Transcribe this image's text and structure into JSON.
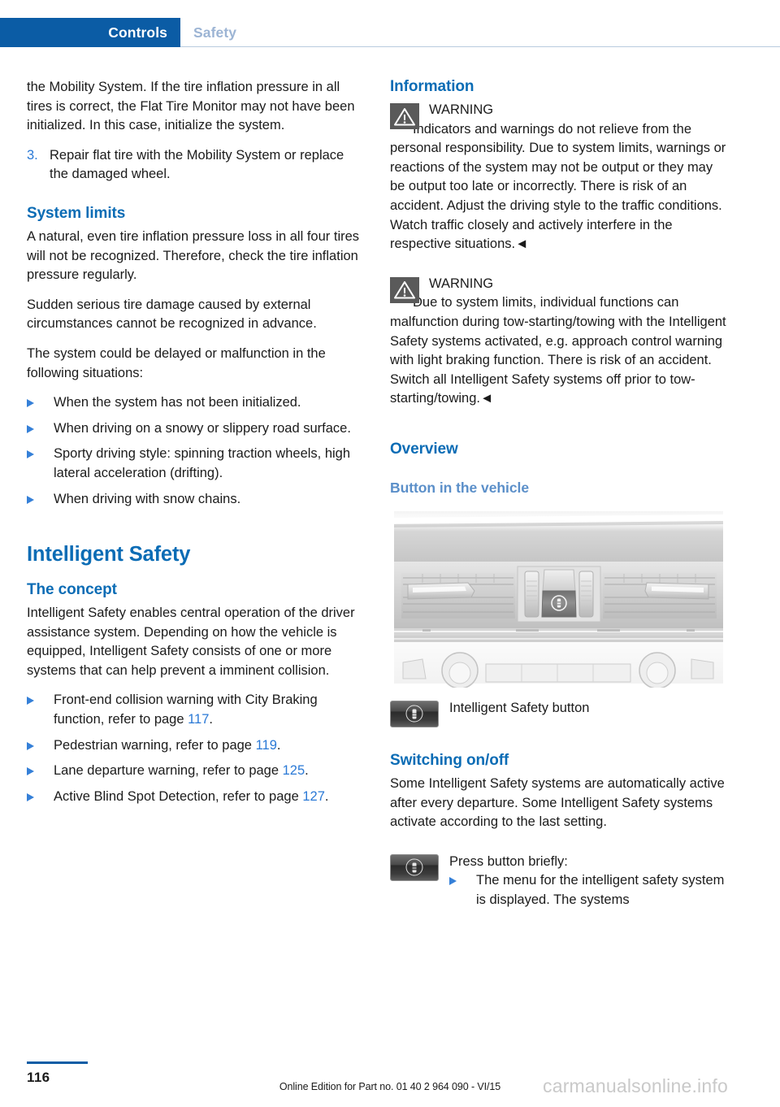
{
  "header": {
    "active_tab": "Controls",
    "inactive_tab": "Safety",
    "active_color": "#0b5ca5",
    "inactive_color": "#9cb4d4"
  },
  "left_column": {
    "continued_paragraph": "the Mobility System. If the tire inflation pressure in all tires is correct, the Flat Tire Monitor may not have been initialized. In this case, initialize the system.",
    "numbered_items": [
      {
        "number": "3.",
        "text": "Repair flat tire with the Mobility System or replace the damaged wheel."
      }
    ],
    "system_limits": {
      "heading": "System limits",
      "paragraphs": [
        "A natural, even tire inflation pressure loss in all four tires will not be recognized. Therefore, check the tire inflation pressure regularly.",
        "Sudden serious tire damage caused by external circumstances cannot be recognized in advance.",
        "The system could be delayed or malfunction in the following situations:"
      ],
      "bullets": [
        "When the system has not been initialized.",
        "When driving on a snowy or slippery road surface.",
        "Sporty driving style: spinning traction wheels, high lateral acceleration (drifting).",
        "When driving with snow chains."
      ]
    },
    "intelligent_safety": {
      "chapter_title": "Intelligent Safety",
      "concept_heading": "The concept",
      "concept_paragraph": "Intelligent Safety enables central operation of the driver assistance system. Depending on how the vehicle is equipped, Intelligent Safety consists of one or more systems that can help prevent a imminent collision.",
      "feature_bullets": [
        {
          "text_before": "Front-end collision warning with City Braking function, refer to page ",
          "page": "117",
          "text_after": "."
        },
        {
          "text_before": "Pedestrian warning, refer to page ",
          "page": "119",
          "text_after": "."
        },
        {
          "text_before": "Lane departure warning, refer to page ",
          "page": "125",
          "text_after": "."
        },
        {
          "text_before": "Active Blind Spot Detection, refer to page ",
          "page": "127",
          "text_after": "."
        }
      ]
    }
  },
  "right_column": {
    "information": {
      "heading": "Information",
      "warnings": [
        {
          "icon": "warning-triangle-icon",
          "title": "WARNING",
          "text": "Indicators and warnings do not relieve from the personal responsibility. Due to system limits, warnings or reactions of the system may not be output or they may be output too late or incorrectly. There is risk of an accident. Adjust the driving style to the traffic conditions. Watch traffic closely and actively interfere in the respective situations.◄"
        },
        {
          "icon": "warning-triangle-icon",
          "title": "WARNING",
          "text": "Due to system limits, individual functions can malfunction during tow-starting/towing with the Intelligent Safety systems activated, e.g. approach control warning with light braking function. There is risk of an accident. Switch all Intelligent Safety systems off prior to tow-starting/towing.◄"
        }
      ]
    },
    "overview": {
      "heading": "Overview",
      "subheading": "Button in the vehicle",
      "figure_alt": "vehicle-dashboard-center-console-figure",
      "figure_caption": "Intelligent Safety button",
      "figure_caption_icon": "intelligent-safety-button-icon"
    },
    "switching": {
      "heading": "Switching on/off",
      "paragraph": "Some Intelligent Safety systems are automatically active after every departure. Some Intelligent Safety systems activate according to the last setting.",
      "action_icon": "intelligent-safety-button-icon",
      "action_label": "Press button briefly:",
      "action_bullets": [
        "The menu for the intelligent safety system is displayed. The systems"
      ]
    }
  },
  "footer": {
    "page_number": "116",
    "edition_note": "Online Edition for Part no. 01 40 2 964 090 - VI/15",
    "watermark": "carmanualsonline.info"
  },
  "colors": {
    "heading_blue": "#0b6cb5",
    "subheading_blue": "#5b8fc9",
    "link_blue": "#2a79d6",
    "header_blue": "#0b5ca5",
    "warn_icon_gray": "#5a5a5a"
  }
}
